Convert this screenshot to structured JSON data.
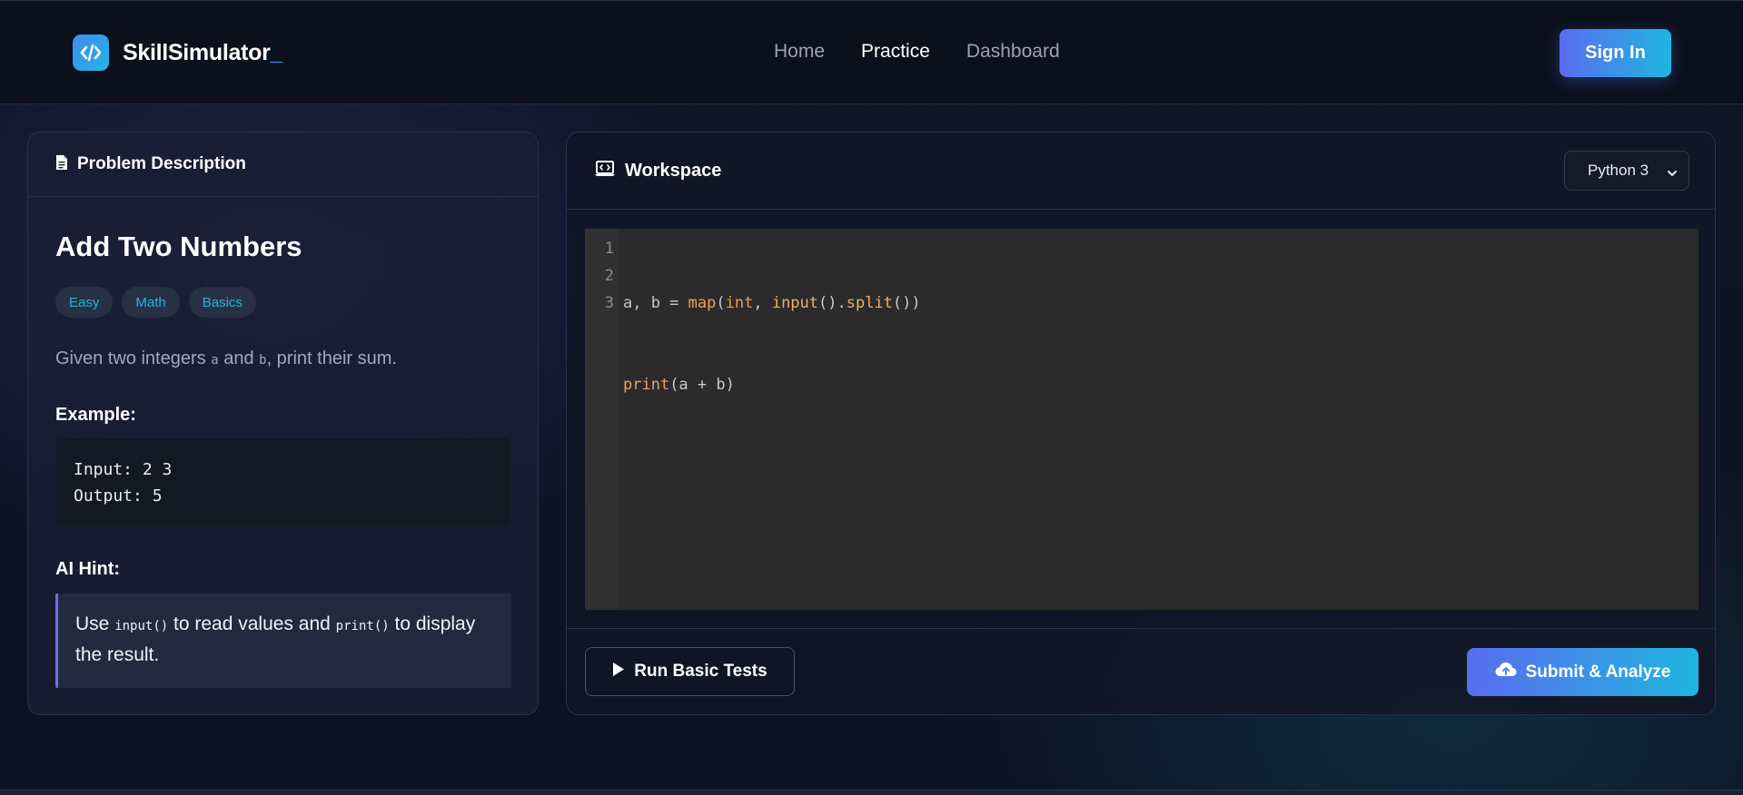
{
  "brand": {
    "name": "SkillSimulator",
    "cursor": "_",
    "logo_icon": "code-icon"
  },
  "nav": {
    "links": [
      {
        "label": "Home",
        "active": false
      },
      {
        "label": "Practice",
        "active": true
      },
      {
        "label": "Dashboard",
        "active": false
      }
    ],
    "sign_in_label": "Sign In"
  },
  "problem": {
    "header_title": "Problem Description",
    "header_icon": "document-icon",
    "title": "Add Two Numbers",
    "tags": [
      "Easy",
      "Math",
      "Basics"
    ],
    "description": {
      "before": "Given two integers ",
      "var_a": "a",
      "middle": " and ",
      "var_b": "b",
      "after": ", print their sum."
    },
    "example_label": "Example:",
    "example_input": "Input: 2 3",
    "example_output": "Output: 5",
    "hint_label": "AI Hint:",
    "hint": {
      "before": "Use ",
      "code1": "input()",
      "middle": " to read values and ",
      "code2": "print()",
      "after": " to display the result."
    }
  },
  "workspace": {
    "title": "Workspace",
    "header_icon": "laptop-code-icon",
    "language": "Python 3",
    "line_numbers": [
      "1",
      "2",
      "3"
    ],
    "code_lines": [
      "a, b = map(int, input().split())",
      "print(a + b)",
      ""
    ],
    "run_label": "Run Basic Tests",
    "submit_label": "Submit & Analyze"
  },
  "colors": {
    "accent_start": "#5a6cf0",
    "accent_end": "#1fb6e0",
    "tag_text": "#22b4e0",
    "hint_border": "#6b6ff0"
  }
}
